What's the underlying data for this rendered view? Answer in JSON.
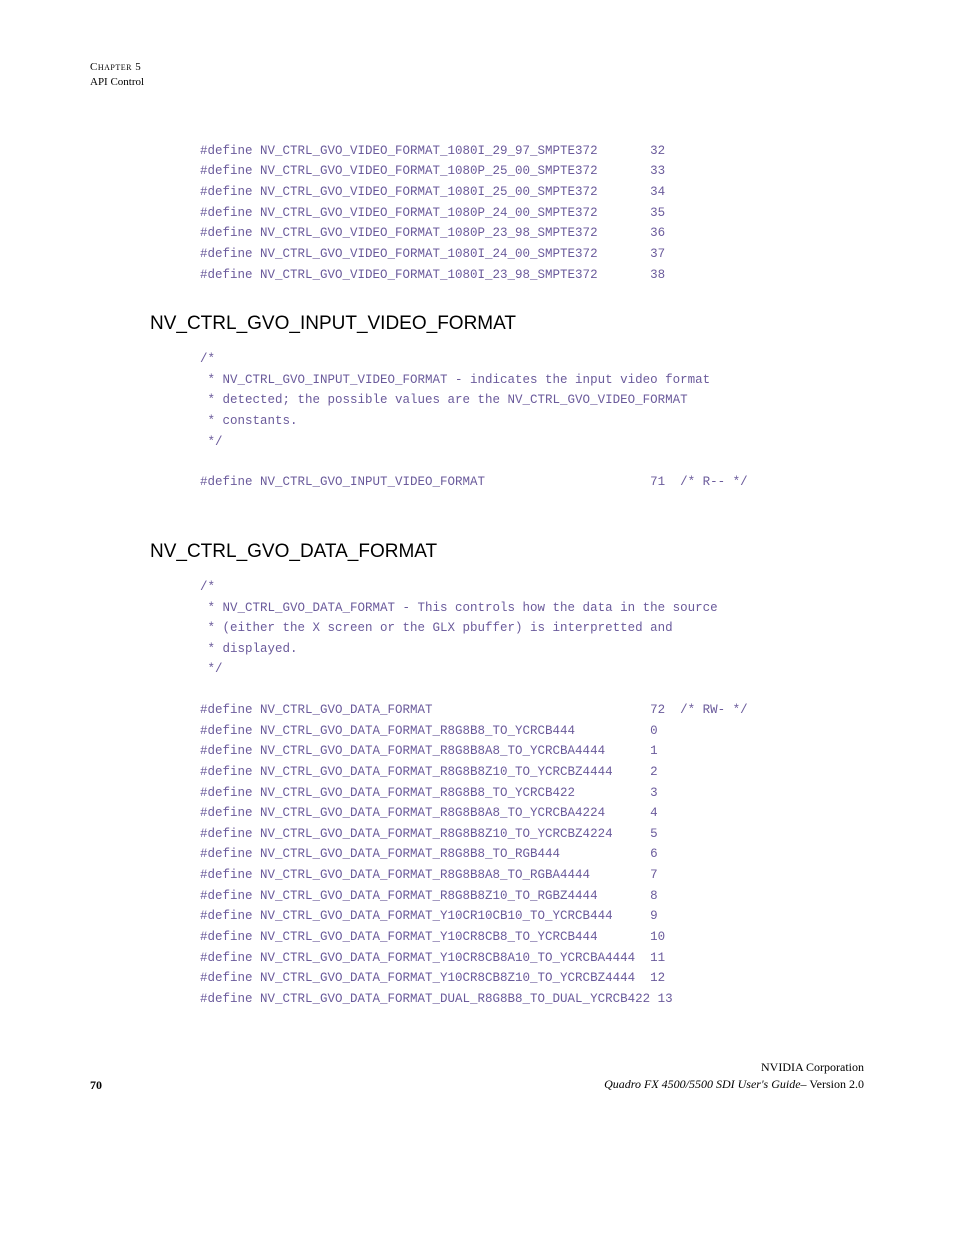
{
  "header": {
    "chapter": "Chapter 5",
    "title": "API Control"
  },
  "topDefines": [
    {
      "name": "#define NV_CTRL_GVO_VIDEO_FORMAT_1080I_29_97_SMPTE372",
      "value": "32"
    },
    {
      "name": "#define NV_CTRL_GVO_VIDEO_FORMAT_1080P_25_00_SMPTE372",
      "value": "33"
    },
    {
      "name": "#define NV_CTRL_GVO_VIDEO_FORMAT_1080I_25_00_SMPTE372",
      "value": "34"
    },
    {
      "name": "#define NV_CTRL_GVO_VIDEO_FORMAT_1080P_24_00_SMPTE372",
      "value": "35"
    },
    {
      "name": "#define NV_CTRL_GVO_VIDEO_FORMAT_1080P_23_98_SMPTE372",
      "value": "36"
    },
    {
      "name": "#define NV_CTRL_GVO_VIDEO_FORMAT_1080I_24_00_SMPTE372",
      "value": "37"
    },
    {
      "name": "#define NV_CTRL_GVO_VIDEO_FORMAT_1080I_23_98_SMPTE372",
      "value": "38"
    }
  ],
  "section1": {
    "heading": "NV_CTRL_GVO_INPUT_VIDEO_FORMAT",
    "comment": "/*\n * NV_CTRL_GVO_INPUT_VIDEO_FORMAT - indicates the input video format\n * detected; the possible values are the NV_CTRL_GVO_VIDEO_FORMAT\n * constants.\n */",
    "define": {
      "name": "#define NV_CTRL_GVO_INPUT_VIDEO_FORMAT",
      "value": "71  /* R-- */"
    }
  },
  "section2": {
    "heading": "NV_CTRL_GVO_DATA_FORMAT",
    "comment": "/*\n * NV_CTRL_GVO_DATA_FORMAT - This controls how the data in the source\n * (either the X screen or the GLX pbuffer) is interpretted and\n * displayed.\n */",
    "defines": [
      {
        "name": "#define NV_CTRL_GVO_DATA_FORMAT",
        "value": "72  /* RW- */"
      },
      {
        "name": "#define NV_CTRL_GVO_DATA_FORMAT_R8G8B8_TO_YCRCB444",
        "value": "0"
      },
      {
        "name": "#define NV_CTRL_GVO_DATA_FORMAT_R8G8B8A8_TO_YCRCBA4444",
        "value": "1"
      },
      {
        "name": "#define NV_CTRL_GVO_DATA_FORMAT_R8G8B8Z10_TO_YCRCBZ4444",
        "value": "2"
      },
      {
        "name": "#define NV_CTRL_GVO_DATA_FORMAT_R8G8B8_TO_YCRCB422",
        "value": "3"
      },
      {
        "name": "#define NV_CTRL_GVO_DATA_FORMAT_R8G8B8A8_TO_YCRCBA4224",
        "value": "4"
      },
      {
        "name": "#define NV_CTRL_GVO_DATA_FORMAT_R8G8B8Z10_TO_YCRCBZ4224",
        "value": "5"
      },
      {
        "name": "#define NV_CTRL_GVO_DATA_FORMAT_R8G8B8_TO_RGB444",
        "value": "6"
      },
      {
        "name": "#define NV_CTRL_GVO_DATA_FORMAT_R8G8B8A8_TO_RGBA4444",
        "value": "7"
      },
      {
        "name": "#define NV_CTRL_GVO_DATA_FORMAT_R8G8B8Z10_TO_RGBZ4444",
        "value": "8"
      },
      {
        "name": "#define NV_CTRL_GVO_DATA_FORMAT_Y10CR10CB10_TO_YCRCB444",
        "value": "9"
      },
      {
        "name": "#define NV_CTRL_GVO_DATA_FORMAT_Y10CR8CB8_TO_YCRCB444",
        "value": "10"
      },
      {
        "name": "#define NV_CTRL_GVO_DATA_FORMAT_Y10CR8CB8A10_TO_YCRCBA4444",
        "value": "11"
      },
      {
        "name": "#define NV_CTRL_GVO_DATA_FORMAT_Y10CR8CB8Z10_TO_YCRCBZ4444",
        "value": "12"
      },
      {
        "name": "#define NV_CTRL_GVO_DATA_FORMAT_DUAL_R8G8B8_TO_DUAL_YCRCB422",
        "value": "13"
      }
    ]
  },
  "footer": {
    "page": "70",
    "company": "NVIDIA Corporation",
    "guide": "Quadro FX 4500/5500 SDI User's Guide",
    "version": "– Version 2.0"
  }
}
